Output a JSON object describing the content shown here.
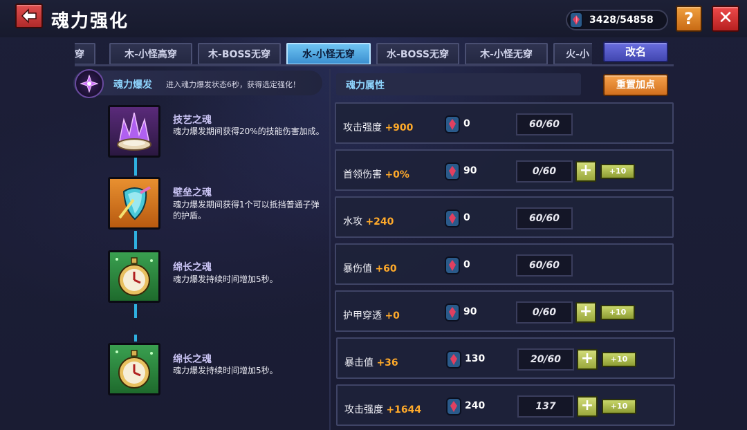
{
  "header": {
    "title": "魂力强化",
    "currency": "3428/54858",
    "help_label": "?",
    "close_label": "✕"
  },
  "tabs": [
    {
      "label": "高穿",
      "active": false
    },
    {
      "label": "木-小怪高穿",
      "active": false
    },
    {
      "label": "木-BOSS无穿",
      "active": false
    },
    {
      "label": "水-小怪无穿",
      "active": true
    },
    {
      "label": "水-BOSS无穿",
      "active": false
    },
    {
      "label": "木-小怪无穿",
      "active": false
    },
    {
      "label": "火-小",
      "active": false
    }
  ],
  "rename_label": "改名",
  "burst": {
    "title": "魂力爆发",
    "desc": "进入魂力爆发状态6秒，获得选定强化！"
  },
  "skills": [
    {
      "name": "技艺之魂",
      "desc": "魂力爆发期间获得20%的技能伤害加成。",
      "icon": "purple-crystal-icon"
    },
    {
      "name": "壁垒之魂",
      "desc": "魂力爆发期间获得1个可以抵挡普通子弹的护盾。",
      "icon": "shield-icon"
    },
    {
      "name": "绵长之魂",
      "desc": "魂力爆发持续时间增加5秒。",
      "icon": "pocket-watch-icon"
    },
    {
      "name": "绵长之魂",
      "desc": "魂力爆发持续时间增加5秒。",
      "icon": "pocket-watch-icon"
    }
  ],
  "attributes_title": "魂力属性",
  "reset_label": "重置加点",
  "attributes": [
    {
      "label": "攻击强度",
      "bonus": "+900",
      "cost": "0",
      "level": "60/60",
      "upgradable": false
    },
    {
      "label": "首领伤害",
      "bonus": "+0%",
      "cost": "90",
      "level": "0/60",
      "upgradable": true
    },
    {
      "label": "水攻",
      "bonus": "+240",
      "cost": "0",
      "level": "60/60",
      "upgradable": false
    },
    {
      "label": "暴伤值",
      "bonus": "+60",
      "cost": "0",
      "level": "60/60",
      "upgradable": false
    },
    {
      "label": "护甲穿透",
      "bonus": "+0",
      "cost": "90",
      "level": "0/60",
      "upgradable": true
    },
    {
      "label": "暴击值",
      "bonus": "+36",
      "cost": "130",
      "level": "20/60",
      "upgradable": true
    },
    {
      "label": "攻击强度",
      "bonus": "+1644",
      "cost": "240",
      "level": "137",
      "upgradable": true
    }
  ],
  "plus_label": "+",
  "plus10_label": "+10",
  "colors": {
    "accent_blue": "#8fd6ff",
    "bonus_orange": "#ffaa2a",
    "active_tab": "#6ec4f2",
    "close_red": "#ee4b4b",
    "help_orange": "#f0a040"
  }
}
